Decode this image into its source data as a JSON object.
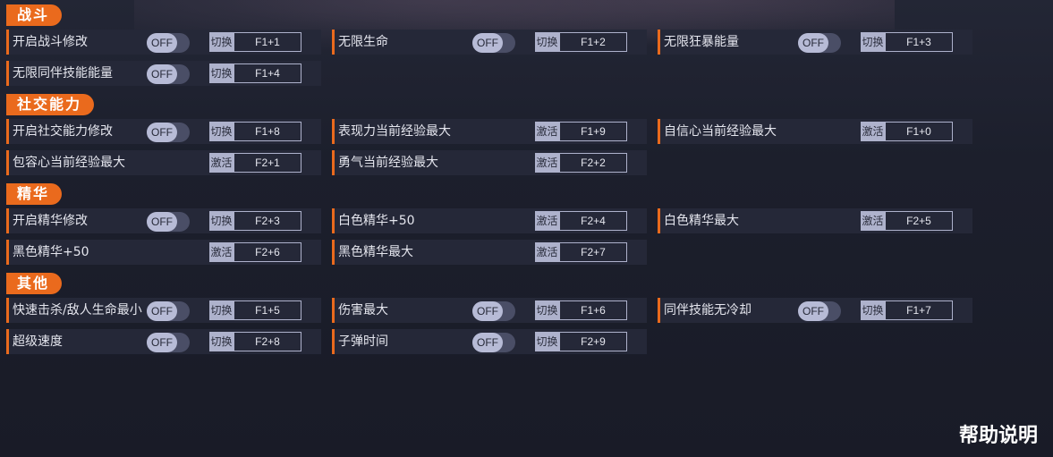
{
  "sections": [
    {
      "title": "战斗",
      "items": [
        {
          "label": "开启战斗修改",
          "toggle": "OFF",
          "action": "切换",
          "key": "F1+1"
        },
        {
          "label": "无限生命",
          "toggle": "OFF",
          "action": "切换",
          "key": "F1+2"
        },
        {
          "label": "无限狂暴能量",
          "toggle": "OFF",
          "action": "切换",
          "key": "F1+3"
        },
        {
          "label": "无限同伴技能能量",
          "toggle": "OFF",
          "action": "切换",
          "key": "F1+4"
        }
      ]
    },
    {
      "title": "社交能力",
      "items": [
        {
          "label": "开启社交能力修改",
          "toggle": "OFF",
          "action": "切换",
          "key": "F1+8"
        },
        {
          "label": "表现力当前经验最大",
          "toggle": null,
          "action": "激活",
          "key": "F1+9"
        },
        {
          "label": "自信心当前经验最大",
          "toggle": null,
          "action": "激活",
          "key": "F1+0"
        },
        {
          "label": "包容心当前经验最大",
          "toggle": null,
          "action": "激活",
          "key": "F2+1"
        },
        {
          "label": "勇气当前经验最大",
          "toggle": null,
          "action": "激活",
          "key": "F2+2"
        }
      ]
    },
    {
      "title": "精华",
      "items": [
        {
          "label": "开启精华修改",
          "toggle": "OFF",
          "action": "切换",
          "key": "F2+3"
        },
        {
          "label": "白色精华+50",
          "toggle": null,
          "action": "激活",
          "key": "F2+4"
        },
        {
          "label": "白色精华最大",
          "toggle": null,
          "action": "激活",
          "key": "F2+5"
        },
        {
          "label": "黑色精华+50",
          "toggle": null,
          "action": "激活",
          "key": "F2+6"
        },
        {
          "label": "黑色精华最大",
          "toggle": null,
          "action": "激活",
          "key": "F2+7"
        }
      ]
    },
    {
      "title": "其他",
      "items": [
        {
          "label": "快速击杀/敌人生命最小",
          "toggle": "OFF",
          "action": "切换",
          "key": "F1+5"
        },
        {
          "label": "伤害最大",
          "toggle": "OFF",
          "action": "切换",
          "key": "F1+6"
        },
        {
          "label": "同伴技能无冷却",
          "toggle": "OFF",
          "action": "切换",
          "key": "F1+7"
        },
        {
          "label": "超级速度",
          "toggle": "OFF",
          "action": "切换",
          "key": "F2+8"
        },
        {
          "label": "子弹时间",
          "toggle": "OFF",
          "action": "切换",
          "key": "F2+9"
        }
      ]
    }
  ],
  "help_label": "帮助说明",
  "colors": {
    "accent": "#ea6a1d",
    "row_bg": "#252838",
    "toggle_knob": "#b7bbd6"
  }
}
